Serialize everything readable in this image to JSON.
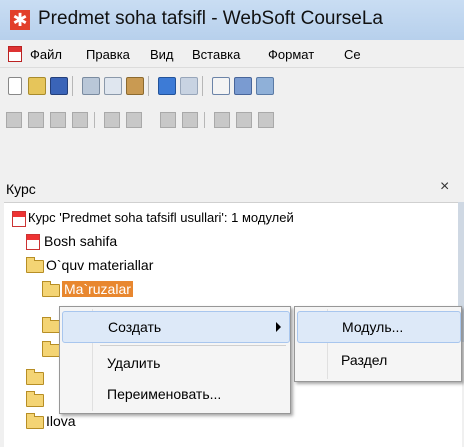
{
  "window": {
    "title": "Predmet soha tafsifl - WebSoft CourseLa",
    "app_icon": "asterisk-app-icon"
  },
  "menubar": {
    "items": [
      "Файл",
      "Правка",
      "Вид",
      "Вставка",
      "Формат",
      "Се"
    ]
  },
  "toolbar1": {
    "icons": [
      "new-document-icon",
      "open-folder-icon",
      "save-icon",
      "cut-icon",
      "copy-icon",
      "paste-icon",
      "undo-icon",
      "redo-icon",
      "insert-text-icon",
      "insert-image-icon",
      "insert-picture-icon"
    ]
  },
  "panel": {
    "title": "Курс",
    "close_glyph": "×"
  },
  "tree": {
    "root": "Курс 'Predmet soha tafsifl usullari': 1 модулей",
    "items": [
      {
        "label": "Bosh sahifa",
        "icon": "page-icon"
      },
      {
        "label": "O`quv materiallar",
        "icon": "folder-open-icon"
      },
      {
        "label": "Ma`ruzalar",
        "icon": "folder-open-icon",
        "selected": true
      },
      {
        "label": "Ilova",
        "icon": "folder-icon"
      }
    ]
  },
  "context_menu": {
    "items": [
      "Создать",
      "Удалить",
      "Переименовать..."
    ]
  },
  "submenu": {
    "items": [
      "Модуль...",
      "Раздел"
    ]
  },
  "colors": {
    "selection": "#e8872f",
    "menu_highlight": "#dde9f8",
    "title_bar": "#c9ddf3"
  }
}
